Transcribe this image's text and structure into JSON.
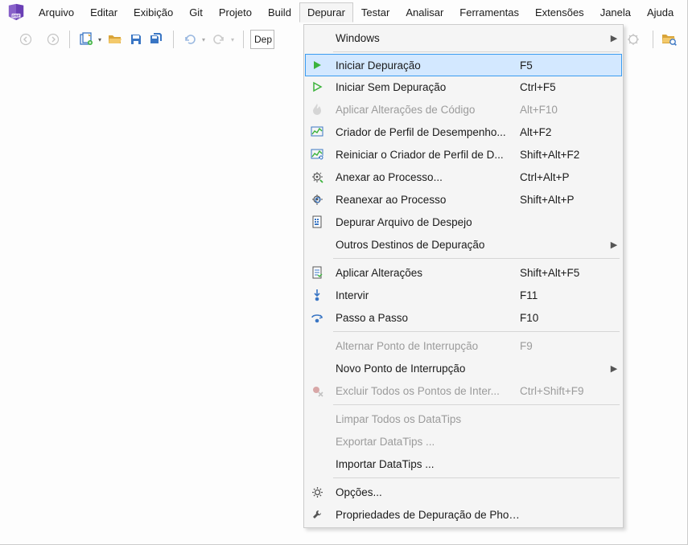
{
  "menubar": {
    "items": [
      {
        "label": "Arquivo"
      },
      {
        "label": "Editar"
      },
      {
        "label": "Exibição"
      },
      {
        "label": "Git"
      },
      {
        "label": "Projeto"
      },
      {
        "label": "Build"
      },
      {
        "label": "Depurar",
        "open": true
      },
      {
        "label": "Testar"
      },
      {
        "label": "Analisar"
      },
      {
        "label": "Ferramentas"
      },
      {
        "label": "Extensões"
      },
      {
        "label": "Janela"
      },
      {
        "label": "Ajuda"
      }
    ]
  },
  "toolbar": {
    "truncated_text": "Dep"
  },
  "dropdown": {
    "groups": [
      [
        {
          "label": "Windows",
          "shortcut": "",
          "submenu": true,
          "icon": ""
        }
      ],
      [
        {
          "label": "Iniciar Depuração",
          "shortcut": "F5",
          "icon": "play-green",
          "highlight": true
        },
        {
          "label": "Iniciar Sem Depuração",
          "shortcut": "Ctrl+F5",
          "icon": "play-outline"
        },
        {
          "label": "Aplicar Alterações de Código",
          "shortcut": "Alt+F10",
          "icon": "flame",
          "disabled": true
        },
        {
          "label": "Criador de Perfil de Desempenho...",
          "shortcut": "Alt+F2",
          "icon": "profiler"
        },
        {
          "label": "Reiniciar o Criador de Perfil de D...",
          "shortcut": "Shift+Alt+F2",
          "icon": "profiler-restart"
        },
        {
          "label": "Anexar ao Processo...",
          "shortcut": "Ctrl+Alt+P",
          "icon": "attach"
        },
        {
          "label": "Reanexar ao Processo",
          "shortcut": "Shift+Alt+P",
          "icon": "reattach"
        },
        {
          "label": "Depurar Arquivo de Despejo",
          "shortcut": "",
          "icon": "dump"
        },
        {
          "label": "Outros Destinos de Depuração",
          "shortcut": "",
          "submenu": true,
          "icon": ""
        }
      ],
      [
        {
          "label": "Aplicar Alterações",
          "shortcut": "Shift+Alt+F5",
          "icon": "apply"
        },
        {
          "label": "Intervir",
          "shortcut": "F11",
          "icon": "step-into"
        },
        {
          "label": "Passo a Passo",
          "shortcut": "F10",
          "icon": "step-over"
        }
      ],
      [
        {
          "label": "Alternar Ponto de Interrupção",
          "shortcut": "F9",
          "icon": "",
          "disabled": true
        },
        {
          "label": "Novo Ponto de Interrupção",
          "shortcut": "",
          "submenu": true,
          "icon": ""
        },
        {
          "label": "Excluir Todos os Pontos de Inter...",
          "shortcut": "Ctrl+Shift+F9",
          "icon": "delete-bp",
          "disabled": true
        }
      ],
      [
        {
          "label": "Limpar Todos os DataTips",
          "shortcut": "",
          "icon": "",
          "disabled": true
        },
        {
          "label": "Exportar DataTips ...",
          "shortcut": "",
          "icon": "",
          "disabled": true
        },
        {
          "label": "Importar DataTips ...",
          "shortcut": "",
          "icon": ""
        }
      ],
      [
        {
          "label": "Opções...",
          "shortcut": "",
          "icon": "gear"
        },
        {
          "label": "Propriedades de Depuração de Phoneword",
          "shortcut": "",
          "icon": "wrench"
        }
      ]
    ]
  }
}
